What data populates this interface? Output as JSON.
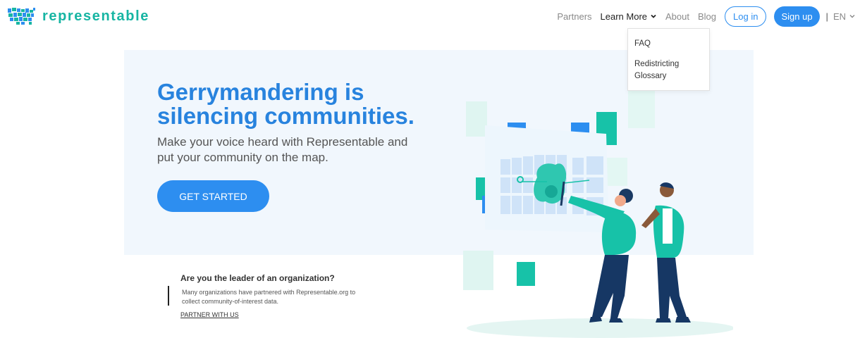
{
  "brand": {
    "name": "representable",
    "logo_icon": "us-map-icon"
  },
  "nav": {
    "partners": "Partners",
    "learn_more": "Learn More",
    "about": "About",
    "blog": "Blog",
    "login": "Log in",
    "signup": "Sign up",
    "separator": "|",
    "language": "EN"
  },
  "dropdown": {
    "items": [
      "FAQ",
      "Redistricting Glossary"
    ]
  },
  "hero": {
    "title": "Gerrymandering is silencing communities.",
    "subtitle": "Make your voice heard with Representable and put your community on the map.",
    "cta": "GET STARTED"
  },
  "org": {
    "question": "Are you the leader of an organization?",
    "description": "Many organizations have partnered with Representable.org to collect community-of-interest data.",
    "link": "PARTNER WITH US"
  },
  "colors": {
    "brand_teal": "#17b5a3",
    "primary_blue": "#2d8ef0",
    "title_blue": "#2883de",
    "hero_bg": "#f1f7fd"
  }
}
